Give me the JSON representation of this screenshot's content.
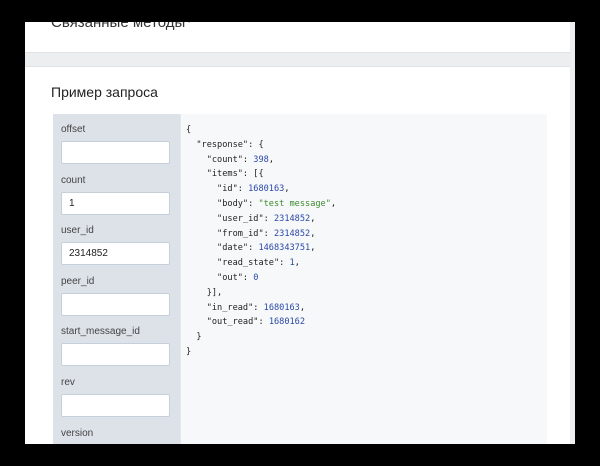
{
  "related": {
    "title": "Связанные методы"
  },
  "example": {
    "title": "Пример запроса",
    "params": [
      {
        "label": "offset",
        "value": ""
      },
      {
        "label": "count",
        "value": "1"
      },
      {
        "label": "user_id",
        "value": "2314852"
      },
      {
        "label": "peer_id",
        "value": ""
      },
      {
        "label": "start_message_id",
        "value": ""
      },
      {
        "label": "rev",
        "value": ""
      },
      {
        "label": "version",
        "value": ""
      }
    ],
    "response": {
      "count": "398",
      "id": "1680163",
      "body": "\"test message\"",
      "user_id": "2314852",
      "from_id": "2314852",
      "date": "1468343751",
      "read_state": "1",
      "out": "0",
      "in_read": "1680163",
      "out_read": "1680162"
    }
  },
  "icons": {
    "chevron": "chevron-down-icon"
  },
  "colors": {
    "background": "#edeef0",
    "card": "#ffffff",
    "params_panel": "#dde1e8",
    "code_panel": "#f7f8fa",
    "code_number": "#2a49a6",
    "code_string": "#3c8a2e"
  }
}
